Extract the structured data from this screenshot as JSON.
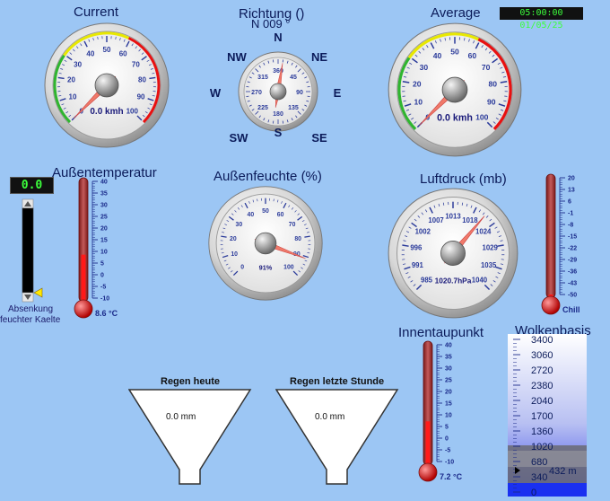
{
  "clock": "05:00:00 01/05/25",
  "gauges": {
    "current": {
      "title": "Current",
      "reading": "0.0 kmh",
      "value": 0,
      "min": 0,
      "max": 110,
      "ticks": [
        "0",
        "10",
        "20",
        "30",
        "40",
        "50",
        "60",
        "70",
        "80",
        "90",
        "100"
      ]
    },
    "average": {
      "title": "Average",
      "reading": "0.0 kmh",
      "value": 0,
      "min": 0,
      "max": 110,
      "ticks": [
        "0",
        "10",
        "20",
        "30",
        "40",
        "50",
        "60",
        "70",
        "80",
        "90",
        "100"
      ]
    },
    "humidity": {
      "title": "Außenfeuchte (%)",
      "reading": "91%",
      "value": 91,
      "min": 0,
      "max": 100,
      "ticks": [
        "0",
        "10",
        "20",
        "30",
        "40",
        "50",
        "60",
        "70",
        "80",
        "90",
        "100"
      ]
    },
    "pressure": {
      "title": "Luftdruck (mb)",
      "reading": "1020.7hPa",
      "value": 1020.7,
      "min": 985,
      "max": 1040,
      "ticks": [
        "985",
        "991",
        "996",
        "1002",
        "1007",
        "1013",
        "1018",
        "1024",
        "1029",
        "1035",
        "1040"
      ]
    }
  },
  "wind_direction": {
    "title": "Richtung ()",
    "reading": "N  009 °",
    "degrees": 9,
    "ticks": [
      "360",
      "45",
      "90",
      "135",
      "180",
      "225",
      "270",
      "315"
    ],
    "cardinals": {
      "n": "N",
      "ne": "NE",
      "e": "E",
      "se": "SE",
      "s": "S",
      "sw": "SW",
      "w": "W",
      "nw": "NW"
    }
  },
  "outdoor_temp": {
    "title": "Außentemperatur",
    "reading": "8.6 °C",
    "value": 8.6,
    "scale": [
      "40",
      "35",
      "30",
      "25",
      "20",
      "15",
      "10",
      "5",
      "0",
      "-5",
      "-10"
    ]
  },
  "dew_point": {
    "title": "Innentaupunkt",
    "reading": "7.2 °C",
    "value": 7.2,
    "scale": [
      "40",
      "35",
      "30",
      "25",
      "20",
      "15",
      "10",
      "5",
      "0",
      "-5",
      "-10"
    ]
  },
  "chill": {
    "label": "Chill",
    "value": -50,
    "scale": [
      "20",
      "13",
      "6",
      "-1",
      "-8",
      "-15",
      "-22",
      "-29",
      "-36",
      "-43",
      "-50"
    ]
  },
  "cooling_slider": {
    "display": "0.0",
    "label_line1": "Absenkung",
    "label_line2": "feuchter Kaelte"
  },
  "rain": {
    "today": {
      "title": "Regen heute",
      "value": "0.0 mm"
    },
    "last_hour": {
      "title": "Regen letzte Stunde",
      "value": "0.0 mm"
    }
  },
  "cloud_base": {
    "title": "Wolkenbasis",
    "reading": "432 m",
    "scale": [
      "3400",
      "3060",
      "2720",
      "2380",
      "2040",
      "1700",
      "1360",
      "1020",
      "680",
      "340",
      "0"
    ]
  }
}
